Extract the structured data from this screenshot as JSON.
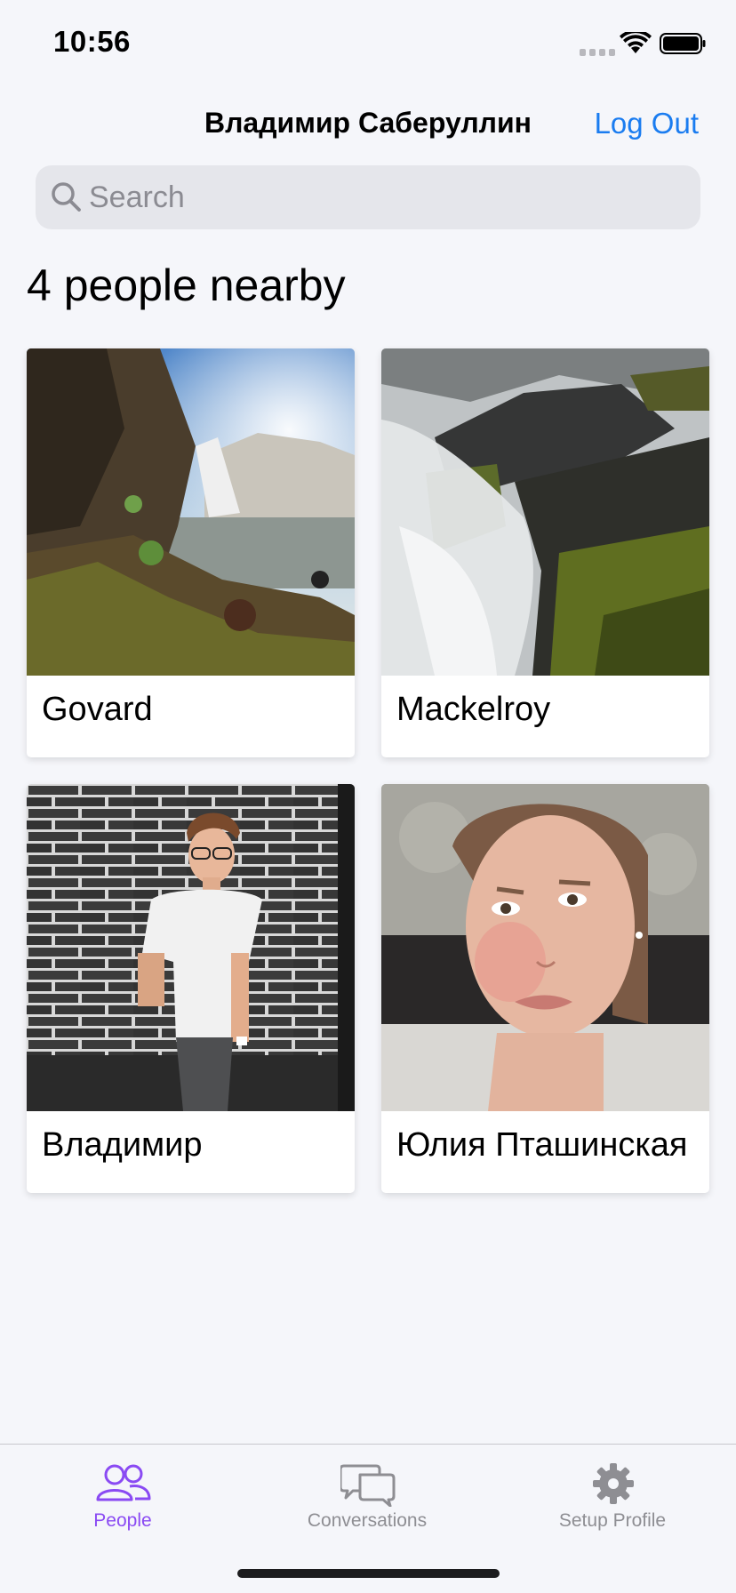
{
  "status": {
    "time": "10:56"
  },
  "nav": {
    "title": "Владимир Саберуллин",
    "logout_label": "Log Out"
  },
  "search": {
    "placeholder": "Search",
    "value": ""
  },
  "section_title": "4 people nearby",
  "people": [
    {
      "name": "Govard",
      "photo": "waterfall-landscape"
    },
    {
      "name": "Mackelroy",
      "photo": "waterfall-rocks"
    },
    {
      "name": "Владимир",
      "photo": "man-brick-wall"
    },
    {
      "name": "Юлия Пташинская",
      "photo": "woman-selfie"
    }
  ],
  "tabs": [
    {
      "label": "People",
      "icon": "people-icon",
      "active": true
    },
    {
      "label": "Conversations",
      "icon": "chat-bubbles-icon",
      "active": false
    },
    {
      "label": "Setup Profile",
      "icon": "gear-icon",
      "active": false
    }
  ],
  "colors": {
    "accent": "#8a4af3",
    "link": "#1a7cf0",
    "inactive": "#8e8e93"
  }
}
